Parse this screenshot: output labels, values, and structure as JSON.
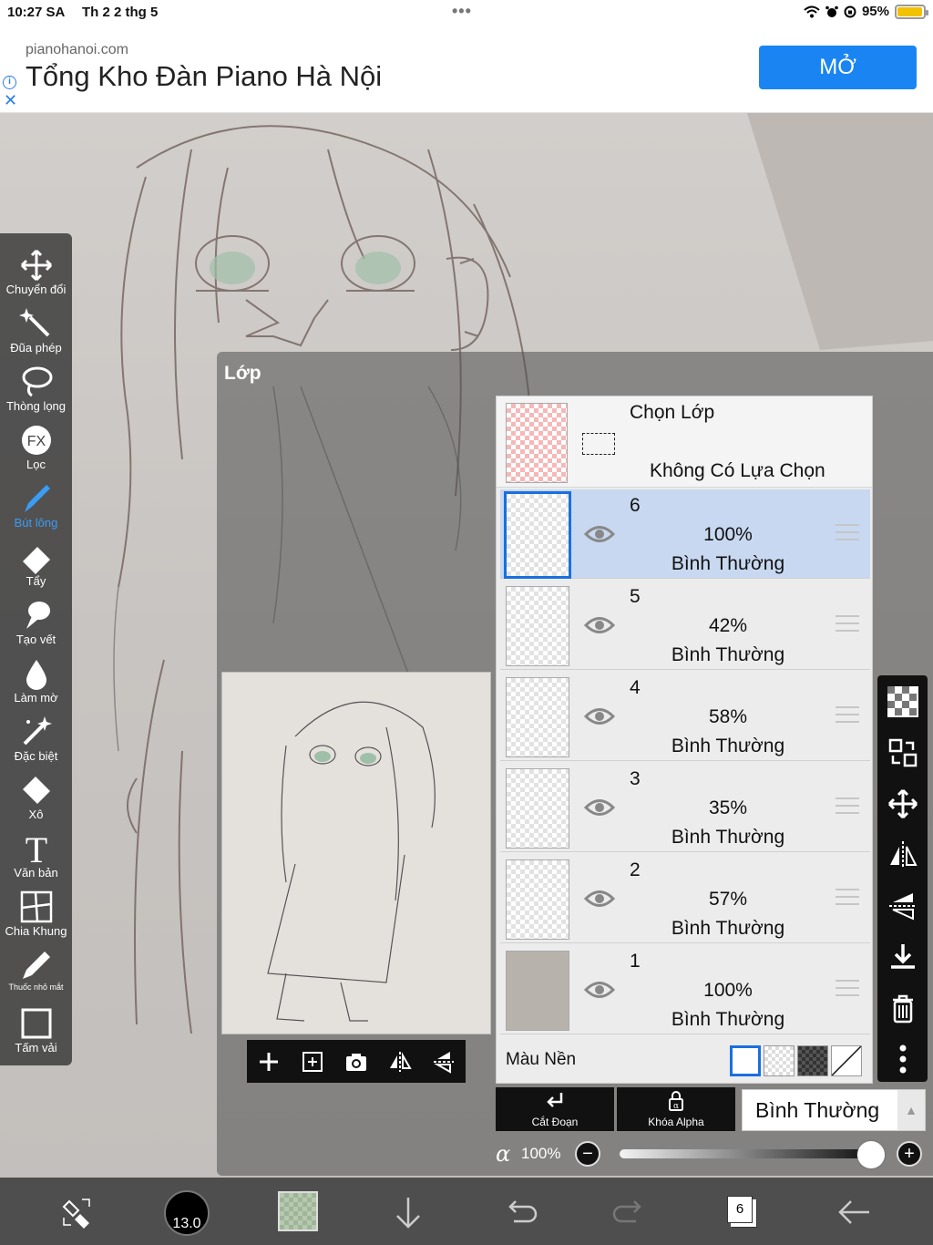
{
  "status_bar": {
    "time": "10:27 SA",
    "date": "Th 2 2 thg 5",
    "battery": "95%",
    "battery_level": 0.95
  },
  "ad": {
    "domain": "pianohanoi.com",
    "headline": "Tổng Kho Đàn Piano Hà Nội",
    "button": "MỞ"
  },
  "toolbar": {
    "tools": [
      {
        "label": "Chuyển đổi",
        "icon": "move-icon"
      },
      {
        "label": "Đũa phép",
        "icon": "magic-wand-icon"
      },
      {
        "label": "Thòng lọng",
        "icon": "lasso-icon"
      },
      {
        "label": "Lọc",
        "icon": "fx-filter-icon"
      },
      {
        "label": "Bút lông",
        "icon": "brush-icon"
      },
      {
        "label": "Tẩy",
        "icon": "eraser-icon"
      },
      {
        "label": "Tạo vết",
        "icon": "smudge-icon"
      },
      {
        "label": "Làm mờ",
        "icon": "blur-icon"
      },
      {
        "label": "Đặc biệt",
        "icon": "special-icon"
      },
      {
        "label": "Xô",
        "icon": "bucket-icon"
      },
      {
        "label": "Văn bản",
        "icon": "text-icon"
      },
      {
        "label": "Chia Khung",
        "icon": "frame-divider-icon"
      },
      {
        "label": "Thuốc nhỏ mắt",
        "icon": "eyedropper-icon"
      },
      {
        "label": "Tấm vải",
        "icon": "canvas-icon"
      }
    ],
    "active": "Bút lông"
  },
  "layer_panel": {
    "title": "Lớp",
    "selection": {
      "title": "Chọn Lớp",
      "status": "Không Có Lựa Chọn"
    },
    "layers": [
      {
        "number": "6",
        "opacity": "100%",
        "mode": "Bình Thường",
        "selected": true
      },
      {
        "number": "5",
        "opacity": "42%",
        "mode": "Bình Thường",
        "selected": false
      },
      {
        "number": "4",
        "opacity": "58%",
        "mode": "Bình Thường",
        "selected": false
      },
      {
        "number": "3",
        "opacity": "35%",
        "mode": "Bình Thường",
        "selected": false
      },
      {
        "number": "2",
        "opacity": "57%",
        "mode": "Bình Thường",
        "selected": false
      },
      {
        "number": "1",
        "opacity": "100%",
        "mode": "Bình Thường",
        "selected": false
      }
    ],
    "background_label": "Màu Nền",
    "clipping_label": "Cắt Đoạn",
    "alpha_lock_label": "Khóa Alpha",
    "blend_mode": "Bình Thường",
    "alpha_symbol": "α",
    "alpha_value": "100%",
    "alpha_level": 1.0
  },
  "bottom_bar": {
    "brush_size": "13.0",
    "layer_count": "6"
  },
  "colors": {
    "accent": "#1a6fe0",
    "ad_button": "#1a85f2",
    "selected_row": "#c8d8f0"
  }
}
